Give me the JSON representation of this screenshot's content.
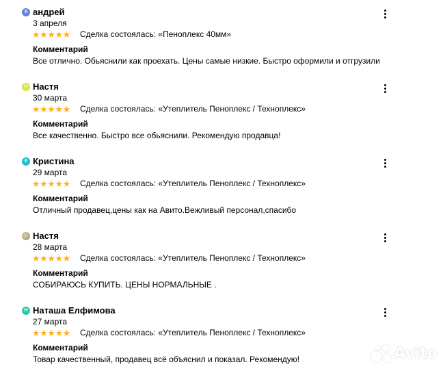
{
  "reviews": [
    {
      "avatar_letter": "А",
      "avatar_color": "#6a7fe0",
      "name": "андрей",
      "date": "3 апреля",
      "rating": 5,
      "stars": "★★★★★",
      "deal": "Сделка состоялась: «Пеноплекс 40мм»",
      "comment_label": "Комментарий",
      "comment": "Все отлично. Обьяснили как проехать. Цены самые низкие. Быстро оформили и отгрузили"
    },
    {
      "avatar_letter": "Н",
      "avatar_color": "#d7e44a",
      "name": "Настя",
      "date": "30 марта",
      "rating": 5,
      "stars": "★★★★★",
      "deal": "Сделка состоялась: «Утеплитель Пеноплекс / Техноплекс»",
      "comment_label": "Комментарий",
      "comment": "Все качественно. Быстро все обьяснили. Рекомендую продавца!"
    },
    {
      "avatar_letter": "К",
      "avatar_color": "#1fbfd6",
      "name": "Кристина",
      "date": "29 марта",
      "rating": 5,
      "stars": "★★★★★",
      "deal": "Сделка состоялась: «Утеплитель Пеноплекс / Техноплекс»",
      "comment_label": "Комментарий",
      "comment": "Отличный продавец,цены как на Авито.Вежливый персонал,спасибо"
    },
    {
      "avatar_letter": "",
      "avatar_color": "",
      "avatar_photo": true,
      "name": "Настя",
      "date": "28 марта",
      "rating": 5,
      "stars": "★★★★★",
      "deal": "Сделка состоялась: «Утеплитель Пеноплекс / Техноплекс»",
      "comment_label": "Комментарий",
      "comment": "СОБИРАЮСЬ КУПИТЬ. ЦЕНЫ НОРМАЛЬНЫЕ ."
    },
    {
      "avatar_letter": "Н",
      "avatar_color": "#2ec7a4",
      "name": "Наташа Елфимова",
      "date": "27 марта",
      "rating": 5,
      "stars": "★★★★★",
      "deal": "Сделка состоялась: «Утеплитель Пеноплекс / Техноплекс»",
      "comment_label": "Комментарий",
      "comment": "Товар качественный, продавец всё объяснил и показал. Рекомендую!"
    }
  ],
  "icons": {
    "more": "more-vertical-icon",
    "star": "star-icon"
  },
  "colors": {
    "star": "#ffb021"
  },
  "watermark": {
    "text": "Avito"
  }
}
